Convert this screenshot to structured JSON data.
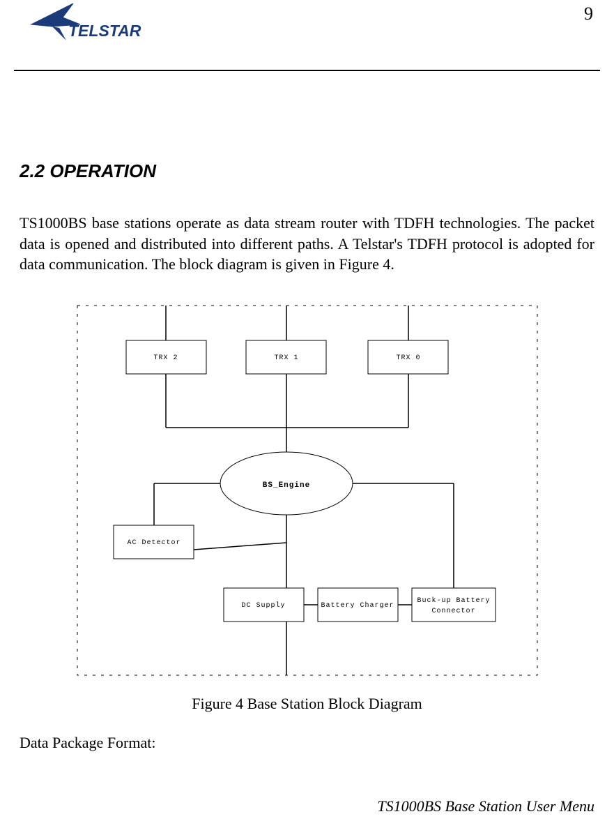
{
  "header": {
    "page_number": "9",
    "logo_text": "TELSTAR"
  },
  "section": {
    "heading": "2.2 OPERATION",
    "paragraph": "TS1000BS base stations operate as data stream router with TDFH technologies. The packet data is opened and distributed into different paths. A Telstar's TDFH protocol is adopted for data communication. The block diagram is given in Figure 4."
  },
  "diagram": {
    "blocks": {
      "trx2": "TRX 2",
      "trx1": "TRX 1",
      "trx0": "TRX 0",
      "bs_engine": "BS_Engine",
      "ac_detector": "AC Detector",
      "dc_supply": "DC Supply",
      "battery_charger": "Battery Charger",
      "buckup_line1": "Buck-up Battery",
      "buckup_line2": "Connector"
    },
    "caption": "Figure 4 Base Station Block Diagram"
  },
  "subheading": "Data Package Format:",
  "footer": "TS1000BS Base Station User Menu"
}
